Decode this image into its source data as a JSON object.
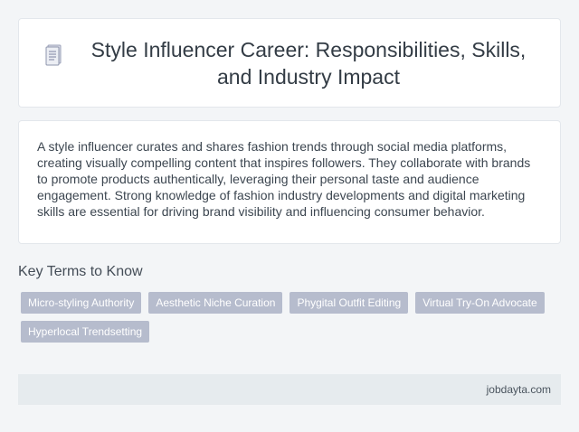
{
  "header": {
    "icon": "document-icon",
    "title": "Style Influencer Career: Responsibilities, Skills, and Industry Impact"
  },
  "summary": {
    "text": "A style influencer curates and shares fashion trends through social media platforms, creating visually compelling content that inspires followers. They collaborate with brands to promote products authentically, leveraging their personal taste and audience engagement. Strong knowledge of fashion industry developments and digital marketing skills are essential for driving brand visibility and influencing consumer behavior."
  },
  "key_terms": {
    "heading": "Key Terms to Know",
    "items": [
      "Micro-styling Authority",
      "Aesthetic Niche Curation",
      "Phygital Outfit Editing",
      "Virtual Try-On Advocate",
      "Hyperlocal Trendsetting"
    ]
  },
  "footer": {
    "site": "jobdayta.com"
  },
  "colors": {
    "background": "#f3f5f7",
    "card": "#ffffff",
    "tag": "#b6bccd",
    "footer": "#e6ebee"
  }
}
